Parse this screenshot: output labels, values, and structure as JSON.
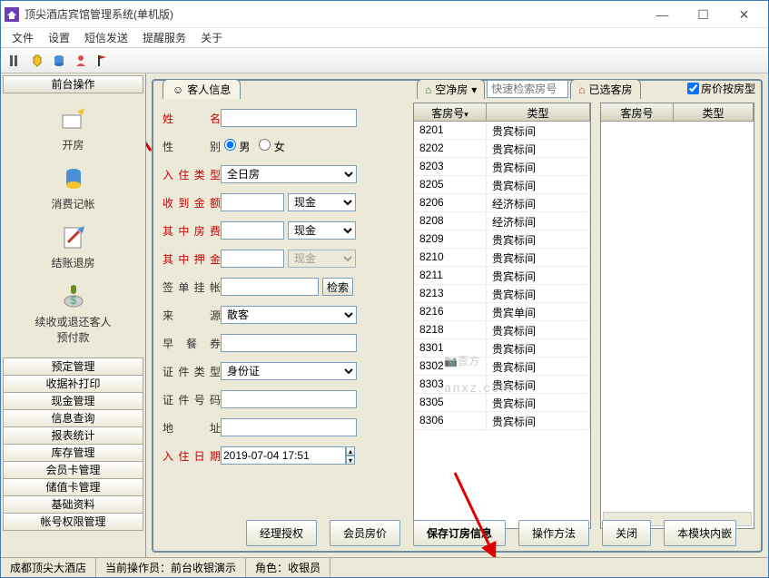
{
  "window": {
    "title": "顶尖酒店宾馆管理系统(单机版)"
  },
  "menubar": [
    "文件",
    "设置",
    "短信发送",
    "提醒服务",
    "关于"
  ],
  "sidebar": {
    "header": "前台操作",
    "icon_items": [
      {
        "label": "开房"
      },
      {
        "label": "消费记帐"
      },
      {
        "label": "结账退房"
      },
      {
        "label": "续收或退还客人\n预付款"
      }
    ],
    "list_items": [
      "预定管理",
      "收据补打印",
      "现金管理",
      "信息查询",
      "报表统计",
      "库存管理",
      "会员卡管理",
      "储值卡管理",
      "基础资料",
      "帐号权限管理"
    ]
  },
  "tabs": {
    "guest_info": "客人信息"
  },
  "form": {
    "name_label": "姓　名",
    "gender_label": "性　别",
    "gender_male": "男",
    "gender_female": "女",
    "checkin_type_label": "入住类型",
    "checkin_type_value": "全日房",
    "amount_label": "收到金额",
    "pay1": "现金",
    "room_fee_label": "其中房费",
    "pay2": "现金",
    "deposit_label": "其中押金",
    "pay3": "现金",
    "sign_label": "签单挂帐",
    "search_btn": "检索",
    "source_label": "来　源",
    "source_value": "散客",
    "breakfast_label": "早 餐 券",
    "id_type_label": "证件类型",
    "id_type_value": "身份证",
    "id_no_label": "证件号码",
    "address_label": "地　址",
    "checkin_date_label": "入住日期",
    "checkin_date_value": "2019-07-04 17:51"
  },
  "mid_tabs": {
    "vacant": "空净房",
    "quick_search_placeholder": "快速检索房号",
    "selected": "已选客房"
  },
  "checkbox_right": "房价按房型",
  "grid_left": {
    "headers": [
      "客房号",
      "类型"
    ],
    "rows": [
      [
        "8201",
        "贵宾标间"
      ],
      [
        "8202",
        "贵宾标间"
      ],
      [
        "8203",
        "贵宾标间"
      ],
      [
        "8205",
        "贵宾标间"
      ],
      [
        "8206",
        "经济标间"
      ],
      [
        "8208",
        "经济标间"
      ],
      [
        "8209",
        "贵宾标间"
      ],
      [
        "8210",
        "贵宾标间"
      ],
      [
        "8211",
        "贵宾标间"
      ],
      [
        "8213",
        "贵宾标间"
      ],
      [
        "8216",
        "贵宾单间"
      ],
      [
        "8218",
        "贵宾标间"
      ],
      [
        "8301",
        "贵宾标间"
      ],
      [
        "8302",
        "贵宾标间"
      ],
      [
        "8303",
        "贵宾标间"
      ],
      [
        "8305",
        "贵宾标间"
      ],
      [
        "8306",
        "贵宾标间"
      ]
    ]
  },
  "grid_right": {
    "headers": [
      "客房号",
      "类型"
    ],
    "rows": []
  },
  "buttons": {
    "mgr_auth": "经理授权",
    "member_price": "会员房价",
    "save": "保存订房信息",
    "help": "操作方法",
    "close": "关闭",
    "embed": "本模块内嵌"
  },
  "statusbar": {
    "hotel": "成都顶尖大酒店",
    "operator_label": "当前操作员：",
    "operator": "前台收银演示",
    "role_label": "角色：",
    "role": "收银员"
  },
  "watermark": {
    "main": "壹方",
    "sub": "anxz.com"
  }
}
